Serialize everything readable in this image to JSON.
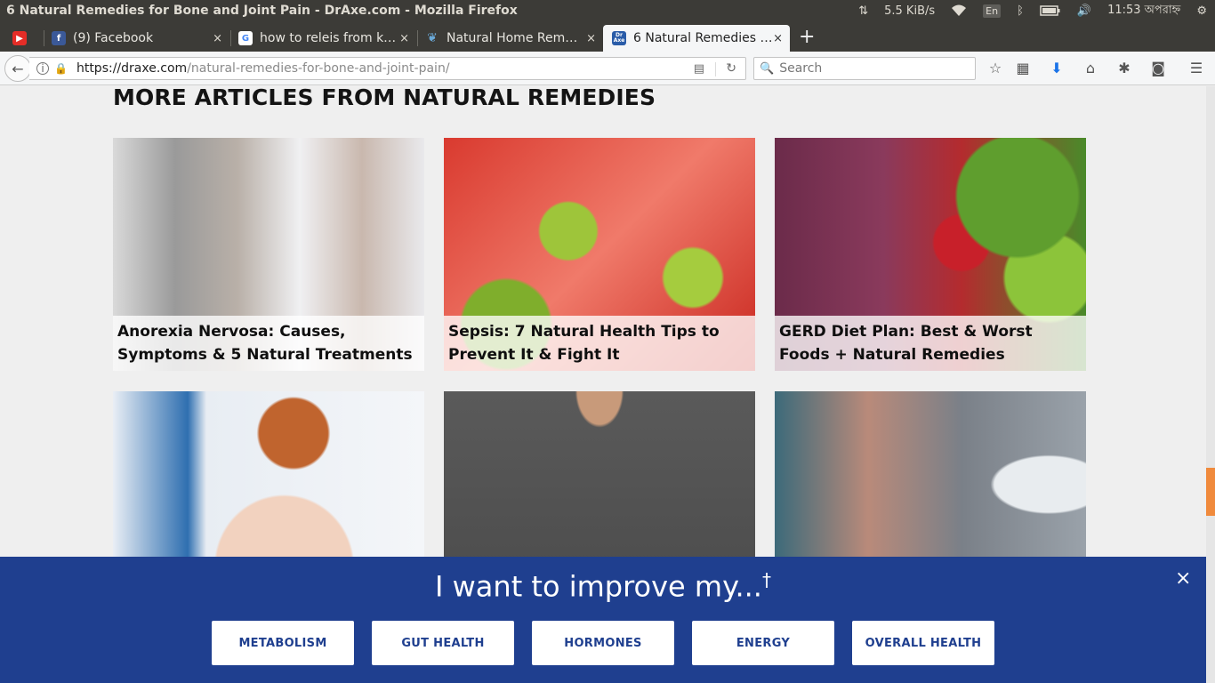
{
  "window": {
    "title": "6 Natural Remedies for Bone and Joint Pain - DrAxe.com - Mozilla Firefox"
  },
  "tray": {
    "speed": "5.5 KiB/s",
    "lang": "En",
    "time": "11:53 অপরাহ্ন"
  },
  "tabs": [
    {
      "label": "",
      "icon": "youtube-icon"
    },
    {
      "label": "(9) Facebook",
      "icon": "facebook-icon"
    },
    {
      "label": "how to releis from k…",
      "icon": "google-icon"
    },
    {
      "label": "Natural Home Rem…",
      "icon": "leaf-icon"
    },
    {
      "label": "6 Natural Remedies …",
      "icon": "draxe-icon",
      "active": true
    }
  ],
  "tab_close_glyph": "×",
  "favicon_text": {
    "facebook": "f",
    "google": "G",
    "leaf": "❦",
    "draxe": "Dr Axe"
  },
  "address": {
    "host": "https://draxe.com",
    "path": "/natural-remedies-for-bone-and-joint-pain/"
  },
  "search": {
    "placeholder": "Search"
  },
  "page": {
    "section_title": "MORE ARTICLES FROM NATURAL REMEDIES",
    "cards": [
      {
        "caption": "Anorexia Nervosa: Causes, Symptoms & 5 Natural Treatments"
      },
      {
        "caption": "Sepsis: 7 Natural Health Tips to Prevent It & Fight It"
      },
      {
        "caption": "GERD Diet Plan: Best & Worst Foods + Natural Remedies"
      },
      {
        "caption": ""
      },
      {
        "caption": ""
      },
      {
        "caption": ""
      }
    ]
  },
  "overlay": {
    "prompt": "I want to improve my...",
    "dagger": "†",
    "close": "×",
    "buttons": [
      "METABOLISM",
      "GUT HEALTH",
      "HORMONES",
      "ENERGY",
      "OVERALL HEALTH"
    ]
  },
  "colors": {
    "overlay_bg": "#1f3f8f",
    "scroll_thumb": "#f08a3c"
  }
}
